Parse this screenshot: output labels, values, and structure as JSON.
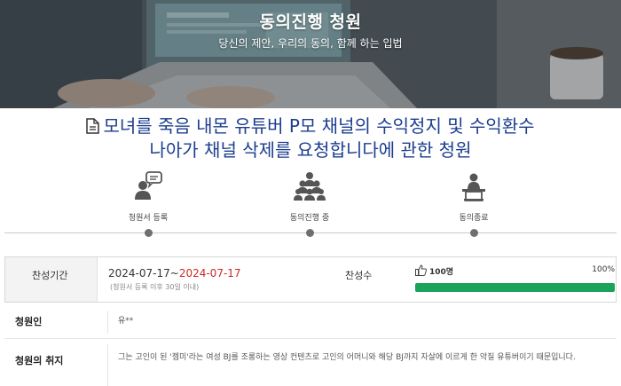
{
  "header": {
    "title": "동의진행 청원",
    "subtitle": "당신의 제안, 우리의 동의, 함께 하는 입법"
  },
  "petition": {
    "title_line1": "모녀를 죽음 내몬 유튜버 P모 채널의 수익정지 및 수익환수",
    "title_line2": "나아가 채널 삭제를 요청합니다에 관한 청원"
  },
  "steps": [
    {
      "label": "청원서 등록",
      "icon": "petition-register-icon"
    },
    {
      "label": "동의진행 중",
      "icon": "agreement-group-icon"
    },
    {
      "label": "동의종료",
      "icon": "podium-icon"
    }
  ],
  "info": {
    "period_label": "찬성기간",
    "date_start": "2024-07-17",
    "date_separator": "~",
    "date_end": "2024-07-17",
    "date_note": "(청원서 등록 이후 30일 이내)",
    "count_label": "찬성수",
    "count_value": "100명",
    "percent_text": "100%",
    "progress": 1.0
  },
  "details": {
    "petitioner_label": "청원인",
    "petitioner_value": "유**",
    "purpose_label": "청원의 취지",
    "purpose_text": "그는 고인이 된 '젬미'라는 여성 BJ를 조롱하는 영상 컨텐츠로 고인의 어머니와 해당 BJ까지 자살에 이르게 한 악질 유튜버이기 때문입니다."
  },
  "colors": {
    "title_blue": "#1b3d8f",
    "end_date_red": "#d02525",
    "progress_green": "#1aa35a"
  }
}
